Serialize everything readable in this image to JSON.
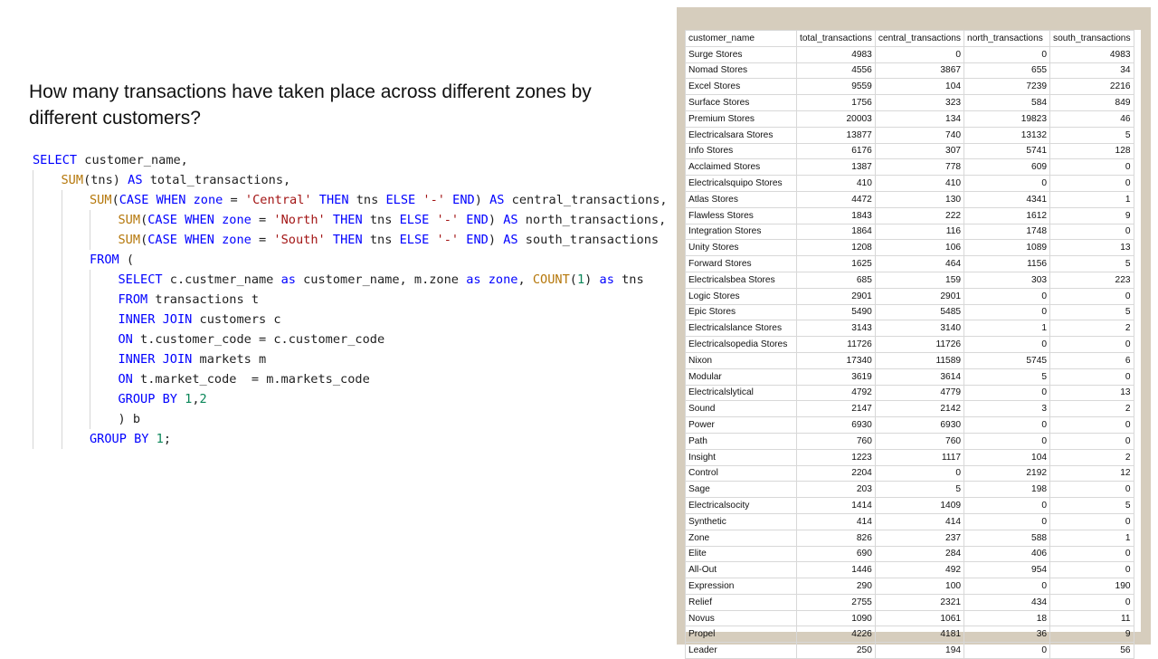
{
  "question": "How many transactions have taken place across different zones by different customers?",
  "code_lines": [
    {
      "indent": 0,
      "parts": [
        {
          "t": "kw",
          "s": "SELECT"
        },
        {
          "t": "tx",
          "s": " customer_name,"
        }
      ]
    },
    {
      "indent": 1,
      "parts": [
        {
          "t": "fn",
          "s": "SUM"
        },
        {
          "t": "tx",
          "s": "(tns) "
        },
        {
          "t": "kw",
          "s": "AS"
        },
        {
          "t": "tx",
          "s": " total_transactions,"
        }
      ]
    },
    {
      "indent": 2,
      "parts": [
        {
          "t": "fn",
          "s": "SUM"
        },
        {
          "t": "tx",
          "s": "("
        },
        {
          "t": "kw",
          "s": "CASE WHEN"
        },
        {
          "t": "tx",
          "s": " "
        },
        {
          "t": "kw",
          "s": "zone"
        },
        {
          "t": "tx",
          "s": " = "
        },
        {
          "t": "st",
          "s": "'Central'"
        },
        {
          "t": "tx",
          "s": " "
        },
        {
          "t": "kw",
          "s": "THEN"
        },
        {
          "t": "tx",
          "s": " tns "
        },
        {
          "t": "kw",
          "s": "ELSE"
        },
        {
          "t": "tx",
          "s": " "
        },
        {
          "t": "st",
          "s": "'-'"
        },
        {
          "t": "tx",
          "s": " "
        },
        {
          "t": "kw",
          "s": "END"
        },
        {
          "t": "tx",
          "s": ") "
        },
        {
          "t": "kw",
          "s": "AS"
        },
        {
          "t": "tx",
          "s": " central_transactions,"
        }
      ]
    },
    {
      "indent": 3,
      "parts": [
        {
          "t": "fn",
          "s": "SUM"
        },
        {
          "t": "tx",
          "s": "("
        },
        {
          "t": "kw",
          "s": "CASE WHEN"
        },
        {
          "t": "tx",
          "s": " "
        },
        {
          "t": "kw",
          "s": "zone"
        },
        {
          "t": "tx",
          "s": " = "
        },
        {
          "t": "st",
          "s": "'North'"
        },
        {
          "t": "tx",
          "s": " "
        },
        {
          "t": "kw",
          "s": "THEN"
        },
        {
          "t": "tx",
          "s": " tns "
        },
        {
          "t": "kw",
          "s": "ELSE"
        },
        {
          "t": "tx",
          "s": " "
        },
        {
          "t": "st",
          "s": "'-'"
        },
        {
          "t": "tx",
          "s": " "
        },
        {
          "t": "kw",
          "s": "END"
        },
        {
          "t": "tx",
          "s": ") "
        },
        {
          "t": "kw",
          "s": "AS"
        },
        {
          "t": "tx",
          "s": " north_transactions,"
        }
      ]
    },
    {
      "indent": 3,
      "parts": [
        {
          "t": "fn",
          "s": "SUM"
        },
        {
          "t": "tx",
          "s": "("
        },
        {
          "t": "kw",
          "s": "CASE WHEN"
        },
        {
          "t": "tx",
          "s": " "
        },
        {
          "t": "kw",
          "s": "zone"
        },
        {
          "t": "tx",
          "s": " = "
        },
        {
          "t": "st",
          "s": "'South'"
        },
        {
          "t": "tx",
          "s": " "
        },
        {
          "t": "kw",
          "s": "THEN"
        },
        {
          "t": "tx",
          "s": " tns "
        },
        {
          "t": "kw",
          "s": "ELSE"
        },
        {
          "t": "tx",
          "s": " "
        },
        {
          "t": "st",
          "s": "'-'"
        },
        {
          "t": "tx",
          "s": " "
        },
        {
          "t": "kw",
          "s": "END"
        },
        {
          "t": "tx",
          "s": ") "
        },
        {
          "t": "kw",
          "s": "AS"
        },
        {
          "t": "tx",
          "s": " south_transactions"
        }
      ]
    },
    {
      "indent": 2,
      "parts": [
        {
          "t": "kw",
          "s": "FROM"
        },
        {
          "t": "tx",
          "s": " ("
        }
      ]
    },
    {
      "indent": 3,
      "parts": [
        {
          "t": "kw",
          "s": "SELECT"
        },
        {
          "t": "tx",
          "s": " c.custmer_name "
        },
        {
          "t": "kw",
          "s": "as"
        },
        {
          "t": "tx",
          "s": " customer_name, m.zone "
        },
        {
          "t": "kw",
          "s": "as"
        },
        {
          "t": "tx",
          "s": " "
        },
        {
          "t": "kw",
          "s": "zone"
        },
        {
          "t": "tx",
          "s": ", "
        },
        {
          "t": "fn",
          "s": "COUNT"
        },
        {
          "t": "tx",
          "s": "("
        },
        {
          "t": "nm",
          "s": "1"
        },
        {
          "t": "tx",
          "s": ") "
        },
        {
          "t": "kw",
          "s": "as"
        },
        {
          "t": "tx",
          "s": " tns"
        }
      ]
    },
    {
      "indent": 3,
      "parts": [
        {
          "t": "kw",
          "s": "FROM"
        },
        {
          "t": "tx",
          "s": " transactions t"
        }
      ]
    },
    {
      "indent": 3,
      "parts": [
        {
          "t": "kw",
          "s": "INNER JOIN"
        },
        {
          "t": "tx",
          "s": " customers c"
        }
      ]
    },
    {
      "indent": 3,
      "parts": [
        {
          "t": "kw",
          "s": "ON"
        },
        {
          "t": "tx",
          "s": " t.customer_code = c.customer_code"
        }
      ]
    },
    {
      "indent": 3,
      "parts": [
        {
          "t": "kw",
          "s": "INNER JOIN"
        },
        {
          "t": "tx",
          "s": " markets m"
        }
      ]
    },
    {
      "indent": 3,
      "parts": [
        {
          "t": "kw",
          "s": "ON"
        },
        {
          "t": "tx",
          "s": " t.market_code  = m.markets_code"
        }
      ]
    },
    {
      "indent": 3,
      "parts": [
        {
          "t": "kw",
          "s": "GROUP BY"
        },
        {
          "t": "tx",
          "s": " "
        },
        {
          "t": "nm",
          "s": "1"
        },
        {
          "t": "tx",
          "s": ","
        },
        {
          "t": "nm",
          "s": "2"
        }
      ]
    },
    {
      "indent": 3,
      "parts": [
        {
          "t": "tx",
          "s": ") b"
        }
      ]
    },
    {
      "indent": 2,
      "parts": [
        {
          "t": "kw",
          "s": "GROUP BY"
        },
        {
          "t": "tx",
          "s": " "
        },
        {
          "t": "nm",
          "s": "1"
        },
        {
          "t": "tx",
          "s": ";"
        }
      ]
    }
  ],
  "table": {
    "columns": [
      "customer_name",
      "total_transactions",
      "central_transactions",
      "north_transactions",
      "south_transactions"
    ],
    "rows": [
      [
        "Surge Stores",
        4983,
        0,
        0,
        4983
      ],
      [
        "Nomad Stores",
        4556,
        3867,
        655,
        34
      ],
      [
        "Excel Stores",
        9559,
        104,
        7239,
        2216
      ],
      [
        "Surface Stores",
        1756,
        323,
        584,
        849
      ],
      [
        "Premium Stores",
        20003,
        134,
        19823,
        46
      ],
      [
        "Electricalsara Stores",
        13877,
        740,
        13132,
        5
      ],
      [
        "Info Stores",
        6176,
        307,
        5741,
        128
      ],
      [
        "Acclaimed Stores",
        1387,
        778,
        609,
        0
      ],
      [
        "Electricalsquipo Stores",
        410,
        410,
        0,
        0
      ],
      [
        "Atlas Stores",
        4472,
        130,
        4341,
        1
      ],
      [
        "Flawless Stores",
        1843,
        222,
        1612,
        9
      ],
      [
        "Integration Stores",
        1864,
        116,
        1748,
        0
      ],
      [
        "Unity Stores",
        1208,
        106,
        1089,
        13
      ],
      [
        "Forward Stores",
        1625,
        464,
        1156,
        5
      ],
      [
        "Electricalsbea Stores",
        685,
        159,
        303,
        223
      ],
      [
        "Logic Stores",
        2901,
        2901,
        0,
        0
      ],
      [
        "Epic Stores",
        5490,
        5485,
        0,
        5
      ],
      [
        "Electricalslance Stores",
        3143,
        3140,
        1,
        2
      ],
      [
        "Electricalsopedia Stores",
        11726,
        11726,
        0,
        0
      ],
      [
        "Nixon",
        17340,
        11589,
        5745,
        6
      ],
      [
        "Modular",
        3619,
        3614,
        5,
        0
      ],
      [
        "Electricalslytical",
        4792,
        4779,
        0,
        13
      ],
      [
        "Sound",
        2147,
        2142,
        3,
        2
      ],
      [
        "Power",
        6930,
        6930,
        0,
        0
      ],
      [
        "Path",
        760,
        760,
        0,
        0
      ],
      [
        "Insight",
        1223,
        1117,
        104,
        2
      ],
      [
        "Control",
        2204,
        0,
        2192,
        12
      ],
      [
        "Sage",
        203,
        5,
        198,
        0
      ],
      [
        "Electricalsocity",
        1414,
        1409,
        0,
        5
      ],
      [
        "Synthetic",
        414,
        414,
        0,
        0
      ],
      [
        "Zone",
        826,
        237,
        588,
        1
      ],
      [
        "Elite",
        690,
        284,
        406,
        0
      ],
      [
        "All-Out",
        1446,
        492,
        954,
        0
      ],
      [
        "Expression",
        290,
        100,
        0,
        190
      ],
      [
        "Relief",
        2755,
        2321,
        434,
        0
      ],
      [
        "Novus",
        1090,
        1061,
        18,
        11
      ],
      [
        "Propel",
        4226,
        4181,
        36,
        9
      ],
      [
        "Leader",
        250,
        194,
        0,
        56
      ]
    ]
  },
  "colors": {
    "keyword": "#0000ff",
    "function": "#b5770a",
    "string": "#a31515",
    "number": "#098658",
    "panel_bg": "#d6cdbd"
  }
}
